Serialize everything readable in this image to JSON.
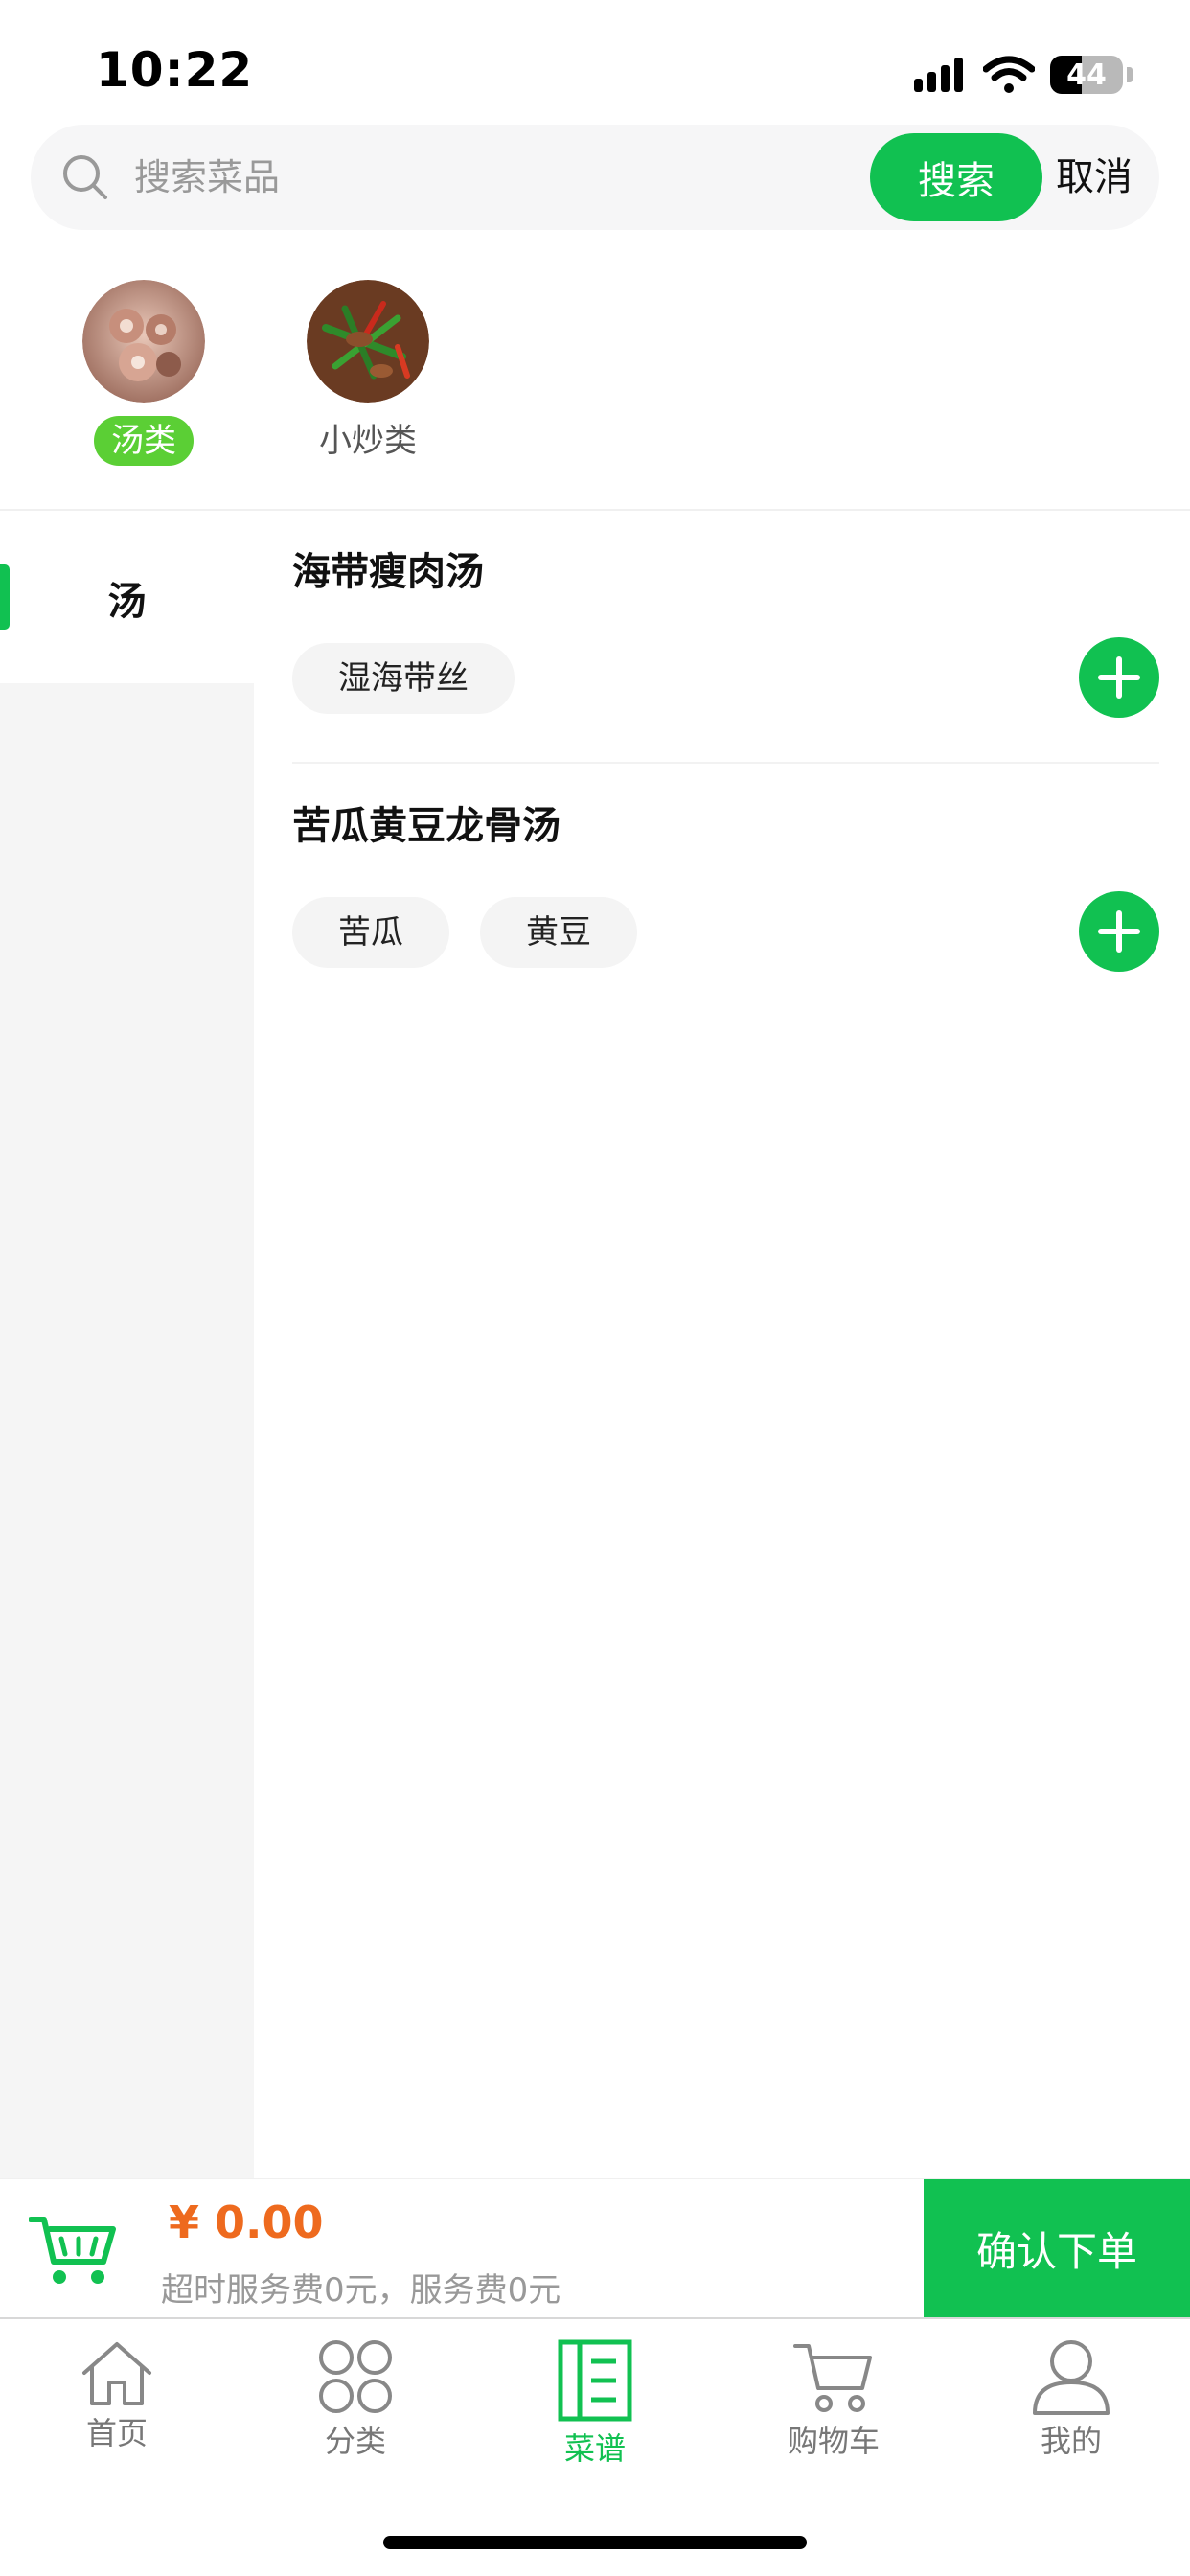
{
  "status_bar": {
    "time": "10:22",
    "battery": "44",
    "battery_level": 0.44
  },
  "search": {
    "placeholder": "搜索菜品",
    "button_label": "搜索",
    "cancel_label": "取消"
  },
  "categories": [
    {
      "label": "汤类",
      "active": true
    },
    {
      "label": "小炒类",
      "active": false
    }
  ],
  "sidebar": {
    "items": [
      {
        "label": "汤",
        "active": true
      }
    ]
  },
  "dishes": [
    {
      "title": "海带瘦肉汤",
      "tags": [
        "湿海带丝"
      ]
    },
    {
      "title": "苦瓜黄豆龙骨汤",
      "tags": [
        "苦瓜",
        "黄豆"
      ]
    }
  ],
  "cart": {
    "price": "¥ 0.00",
    "fee_text": "超时服务费0元，服务费0元",
    "confirm_label": "确认下单"
  },
  "tab_bar": {
    "tabs": [
      {
        "label": "首页",
        "icon": "home-icon"
      },
      {
        "label": "分类",
        "icon": "category-icon"
      },
      {
        "label": "菜谱",
        "icon": "recipe-icon",
        "active": true
      },
      {
        "label": "购物车",
        "icon": "cart-icon"
      },
      {
        "label": "我的",
        "icon": "user-icon"
      }
    ]
  },
  "colors": {
    "accent": "#11c151",
    "price": "#ee6a1e",
    "active_category_label": "#5bcf35"
  }
}
